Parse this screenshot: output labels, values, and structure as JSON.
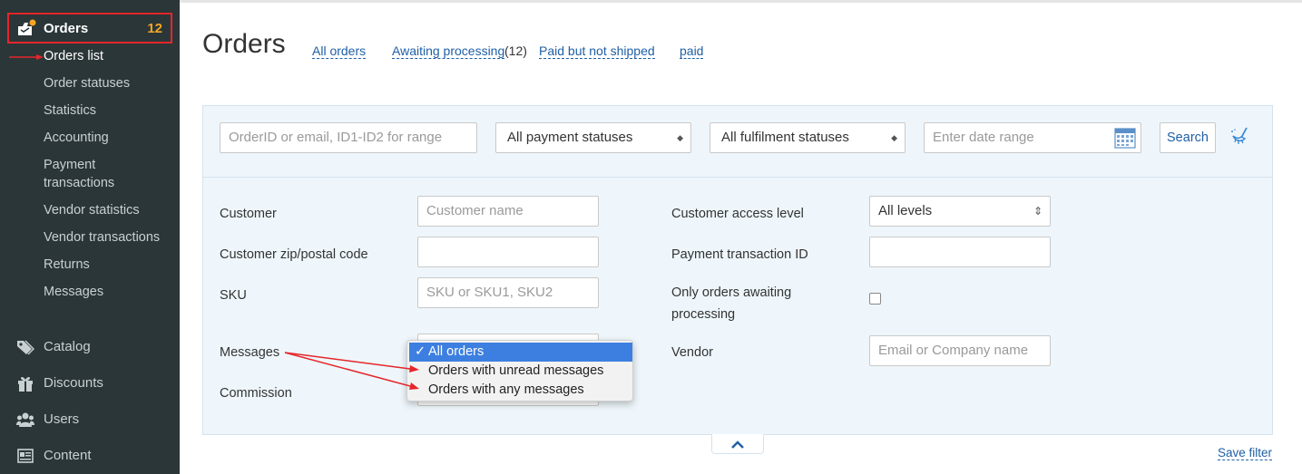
{
  "sidebar": {
    "orders": {
      "label": "Orders",
      "count": "12"
    },
    "sub_items": [
      {
        "label": "Orders list",
        "active": true
      },
      {
        "label": "Order statuses"
      },
      {
        "label": "Statistics"
      },
      {
        "label": "Accounting"
      },
      {
        "label": "Payment"
      },
      {
        "label": "transactions"
      },
      {
        "label": "Vendor statistics"
      },
      {
        "label": "Vendor transactions"
      },
      {
        "label": "Returns"
      },
      {
        "label": "Messages"
      }
    ],
    "main_items": [
      {
        "label": "Catalog",
        "icon": "tag-icon"
      },
      {
        "label": "Discounts",
        "icon": "gift-icon"
      },
      {
        "label": "Users",
        "icon": "users-icon"
      },
      {
        "label": "Content",
        "icon": "content-icon"
      }
    ]
  },
  "header": {
    "title": "Orders",
    "links": [
      {
        "label": "All orders"
      },
      {
        "label": "Awaiting processing",
        "count": "(12)"
      },
      {
        "label": "Paid but not shipped"
      },
      {
        "label": "paid"
      }
    ]
  },
  "filters": {
    "order_search_placeholder": "OrderID or email, ID1-ID2 for range",
    "payment_status": "All payment statuses",
    "fulfilment_status": "All fulfilment statuses",
    "date_placeholder": "Enter date range",
    "search_label": "Search"
  },
  "form": {
    "customer_label": "Customer",
    "customer_placeholder": "Customer name",
    "zip_label": "Customer zip/postal code",
    "sku_label": "SKU",
    "sku_placeholder": "SKU or SKU1, SKU2",
    "messages_label": "Messages",
    "commission_label": "Commission",
    "access_level_label": "Customer access level",
    "access_level_value": "All levels",
    "payment_txn_label": "Payment transaction ID",
    "awaiting_label_1": "Only orders awaiting",
    "awaiting_label_2": "processing",
    "vendor_label": "Vendor",
    "vendor_placeholder": "Email or Company name"
  },
  "messages_dropdown": {
    "check": "✓",
    "options": [
      "All orders",
      "Orders with unread messages",
      "Orders with any messages"
    ],
    "selected": "All orders"
  },
  "footer": {
    "save_filter": "Save filter"
  },
  "colors": {
    "sidebar_bg": "#2b3638",
    "accent_orange": "#f5a623",
    "highlight_red": "#e5262b",
    "link_blue": "#1f5fa5",
    "panel_bg": "#eef6fb",
    "dropdown_selected": "#3d7fe0"
  }
}
